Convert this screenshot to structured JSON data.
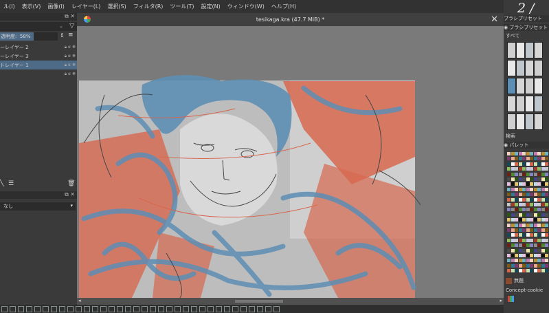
{
  "menubar": {
    "items": [
      "ル(I)",
      "表示(V)",
      "画像(I)",
      "レイヤー(L)",
      "選択(S)",
      "フィルタ(R)",
      "ツール(T)",
      "設定(N)",
      "ウィンドウ(W)",
      "ヘルプ(H)"
    ]
  },
  "layers_panel": {
    "opacity_label": "透明度:",
    "opacity_value": "58%",
    "layers": [
      {
        "name": "ーレイヤー 2",
        "selected": false
      },
      {
        "name": "ーレイヤー 3",
        "selected": false
      },
      {
        "name": "トレイヤー 1",
        "selected": true
      }
    ]
  },
  "tool_options": {
    "preset_value": "なし"
  },
  "document": {
    "title": "tesikaga.kra (47.7 MiB) *"
  },
  "brush_presets": {
    "panel_title": "ブラシプリセット",
    "tab_title": "ブラシプリセット",
    "filter_label": "すべて",
    "search_label": "検索"
  },
  "palette": {
    "panel_title": "パレット",
    "current_color_name": "無題",
    "palette_name": "Concept-cookie"
  },
  "watermark": {
    "text": "2 /"
  },
  "colors": {
    "accent_orange": "#d7684f",
    "stroke_blue": "#5d8eb4",
    "selection": "#4d6a87",
    "bg_canvas": "#7a7a7a"
  }
}
